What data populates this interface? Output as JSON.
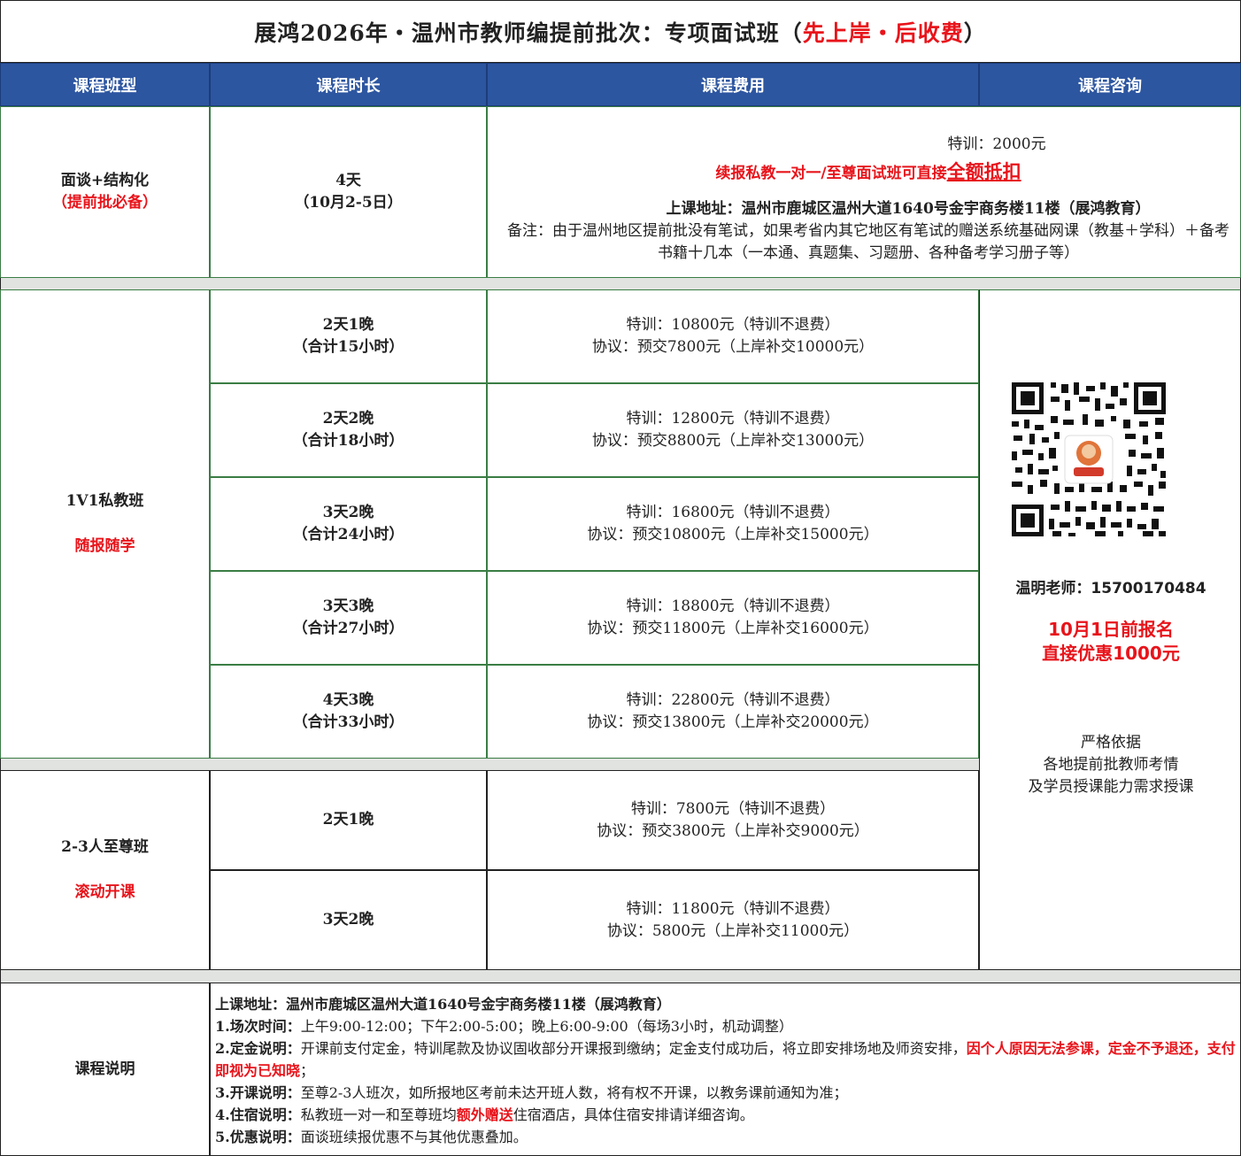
{
  "title": {
    "prefix": "展鸿2026年・温州市教师编提前批次：专项面试班（",
    "highlight": "先上岸・后收费",
    "suffix": "）"
  },
  "headers": [
    "课程班型",
    "课程时长",
    "课程费用",
    "课程咨询"
  ],
  "row1": {
    "type": "面谈+结构化",
    "type_note": "（提前批必备）",
    "duration": "4天",
    "duration_note": "（10月2-5日）",
    "fee": "特训：2000元",
    "promo_prefix": "续报私教一对一/至尊面试班可直接",
    "promo_highlight": "全额抵扣",
    "address": "上课地址：温州市鹿城区温州大道1640号金宇商务楼11楼（展鸿教育）",
    "remark": "备注：由于温州地区提前批没有笔试，如果考省内其它地区有笔试的赠送系统基础网课（教基＋学科）＋备考书籍十几本（一本通、真题集、习题册、各种备考学习册子等）"
  },
  "group_1v1": {
    "type": "1V1私教班",
    "type_note": "随报随学",
    "rows": [
      {
        "duration": "2天1晚",
        "hours": "（合计15小时）",
        "fee": "特训：10800元（特训不退费）",
        "deal": "协议：预交7800元（上岸补交10000元）"
      },
      {
        "duration": "2天2晚",
        "hours": "（合计18小时）",
        "fee": "特训：12800元（特训不退费）",
        "deal": "协议：预交8800元（上岸补交13000元）"
      },
      {
        "duration": "3天2晚",
        "hours": "（合计24小时）",
        "fee": "特训：16800元（特训不退费）",
        "deal": "协议：预交10800元（上岸补交15000元）"
      },
      {
        "duration": "3天3晚",
        "hours": "（合计27小时）",
        "fee": "特训：18800元（特训不退费）",
        "deal": "协议：预交11800元（上岸补交16000元）"
      },
      {
        "duration": "4天3晚",
        "hours": "（合计33小时）",
        "fee": "特训：22800元（特训不退费）",
        "deal": "协议：预交13800元（上岸补交20000元）"
      }
    ]
  },
  "group_vip": {
    "type": "2-3人至尊班",
    "type_note": "滚动开课",
    "rows": [
      {
        "duration": "2天1晚",
        "fee": "特训：7800元（特训不退费）",
        "deal": "协议：预交3800元（上岸补交9000元）"
      },
      {
        "duration": "3天2晚",
        "fee": "特训：11800元（特训不退费）",
        "deal": "协议：5800元（上岸补交11000元）"
      }
    ]
  },
  "consult": {
    "teacher": "温明老师：15700170484",
    "offer_line1": "10月1日前报名",
    "offer_line2": "直接优惠1000元",
    "basis_line1": "严格依据",
    "basis_line2": "各地提前批教师考情",
    "basis_line3": "及学员授课能力需求授课"
  },
  "notes": {
    "label": "课程说明",
    "address": "上课地址：温州市鹿城区温州大道1640号金宇商务楼11楼（展鸿教育）",
    "n1_head": "1.场次时间：",
    "n1_body": "上午9:00-12:00；下午2:00-5:00；晚上6:00-9:00（每场3小时，机动调整）",
    "n2_head": "2.定金说明：",
    "n2_body": "开课前支付定金，特训尾款及协议固收部分开课报到缴纳；定金支付成功后，将立即安排场地及师资安排，",
    "n2_red": "因个人原因无法参课，定金不予退还，支付即视为已知晓",
    "n2_end": "；",
    "n3_head": "3.开课说明：",
    "n3_body": "至尊2-3人班次，如所报地区考前未达开班人数，将有权不开课，以教务课前通知为准；",
    "n4_head": "4.住宿说明：",
    "n4_body1": "私教班一对一和至尊班均",
    "n4_red": "额外赠送",
    "n4_body2": "住宿酒店，具体住宿安排请详细咨询。",
    "n5_head": "5.优惠说明：",
    "n5_body": "面谈班续报优惠不与其他优惠叠加。"
  },
  "colors": {
    "header_bg": "#2d56a0",
    "accent_red": "#e8141b",
    "gap_gray": "#e1e3e1"
  },
  "icons": {
    "qr": "qr-code-icon"
  }
}
